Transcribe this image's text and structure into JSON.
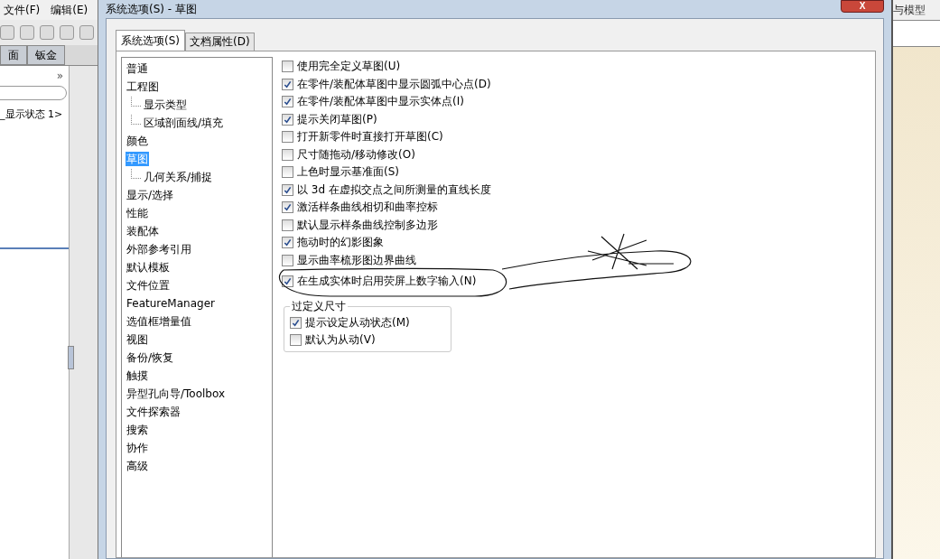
{
  "background_app": {
    "menu": [
      "文件(F)",
      "编辑(E)"
    ],
    "tabs": [
      {
        "label": "面",
        "selected": false
      },
      {
        "label": "钣金",
        "selected": false
      }
    ],
    "expand": "»",
    "tree_item": "_显示状态 1>"
  },
  "right_app": {
    "title": "与模型"
  },
  "dialog": {
    "title": "系统选项(S) - 草图",
    "close": "X",
    "tabs": [
      {
        "label": "系统选项(S)",
        "selected": true
      },
      {
        "label": "文档属性(D)",
        "selected": false
      }
    ],
    "categories": [
      {
        "label": "普通",
        "selected": false
      },
      {
        "label": "工程图",
        "selected": false,
        "children": [
          {
            "label": "显示类型",
            "selected": false
          },
          {
            "label": "区域剖面线/填充",
            "selected": false
          }
        ]
      },
      {
        "label": "颜色",
        "selected": false
      },
      {
        "label": "草图",
        "selected": true,
        "children": [
          {
            "label": "几何关系/捕捉",
            "selected": false
          }
        ]
      },
      {
        "label": "显示/选择",
        "selected": false
      },
      {
        "label": "性能",
        "selected": false
      },
      {
        "label": "装配体",
        "selected": false
      },
      {
        "label": "外部参考引用",
        "selected": false
      },
      {
        "label": "默认模板",
        "selected": false
      },
      {
        "label": "文件位置",
        "selected": false
      },
      {
        "label": "FeatureManager",
        "selected": false
      },
      {
        "label": "选值框增量值",
        "selected": false
      },
      {
        "label": "视图",
        "selected": false
      },
      {
        "label": "备份/恢复",
        "selected": false
      },
      {
        "label": "触摸",
        "selected": false
      },
      {
        "label": "异型孔向导/Toolbox",
        "selected": false
      },
      {
        "label": "文件探索器",
        "selected": false
      },
      {
        "label": "搜索",
        "selected": false
      },
      {
        "label": "协作",
        "selected": false
      },
      {
        "label": "高级",
        "selected": false
      }
    ],
    "options": [
      {
        "label": "使用完全定义草图(U)",
        "checked": false
      },
      {
        "label": "在零件/装配体草图中显示圆弧中心点(D)",
        "checked": true
      },
      {
        "label": "在零件/装配体草图中显示实体点(I)",
        "checked": true
      },
      {
        "label": "提示关闭草图(P)",
        "checked": true
      },
      {
        "label": "打开新零件时直接打开草图(C)",
        "checked": false
      },
      {
        "label": "尺寸随拖动/移动修改(O)",
        "checked": false
      },
      {
        "label": "上色时显示基准面(S)",
        "checked": false
      },
      {
        "label": "以 3d 在虚拟交点之间所测量的直线长度",
        "checked": true
      },
      {
        "label": "激活样条曲线相切和曲率控标",
        "checked": true
      },
      {
        "label": "默认显示样条曲线控制多边形",
        "checked": false
      },
      {
        "label": "拖动时的幻影图象",
        "checked": true
      },
      {
        "label": "显示曲率梳形图边界曲线",
        "checked": false
      },
      {
        "label": "在生成实体时启用荧屏上数字输入(N)",
        "checked": true
      }
    ],
    "group": {
      "title": "过定义尺寸",
      "options": [
        {
          "label": "提示设定从动状态(M)",
          "checked": true
        },
        {
          "label": "默认为从动(V)",
          "checked": false
        }
      ]
    }
  }
}
